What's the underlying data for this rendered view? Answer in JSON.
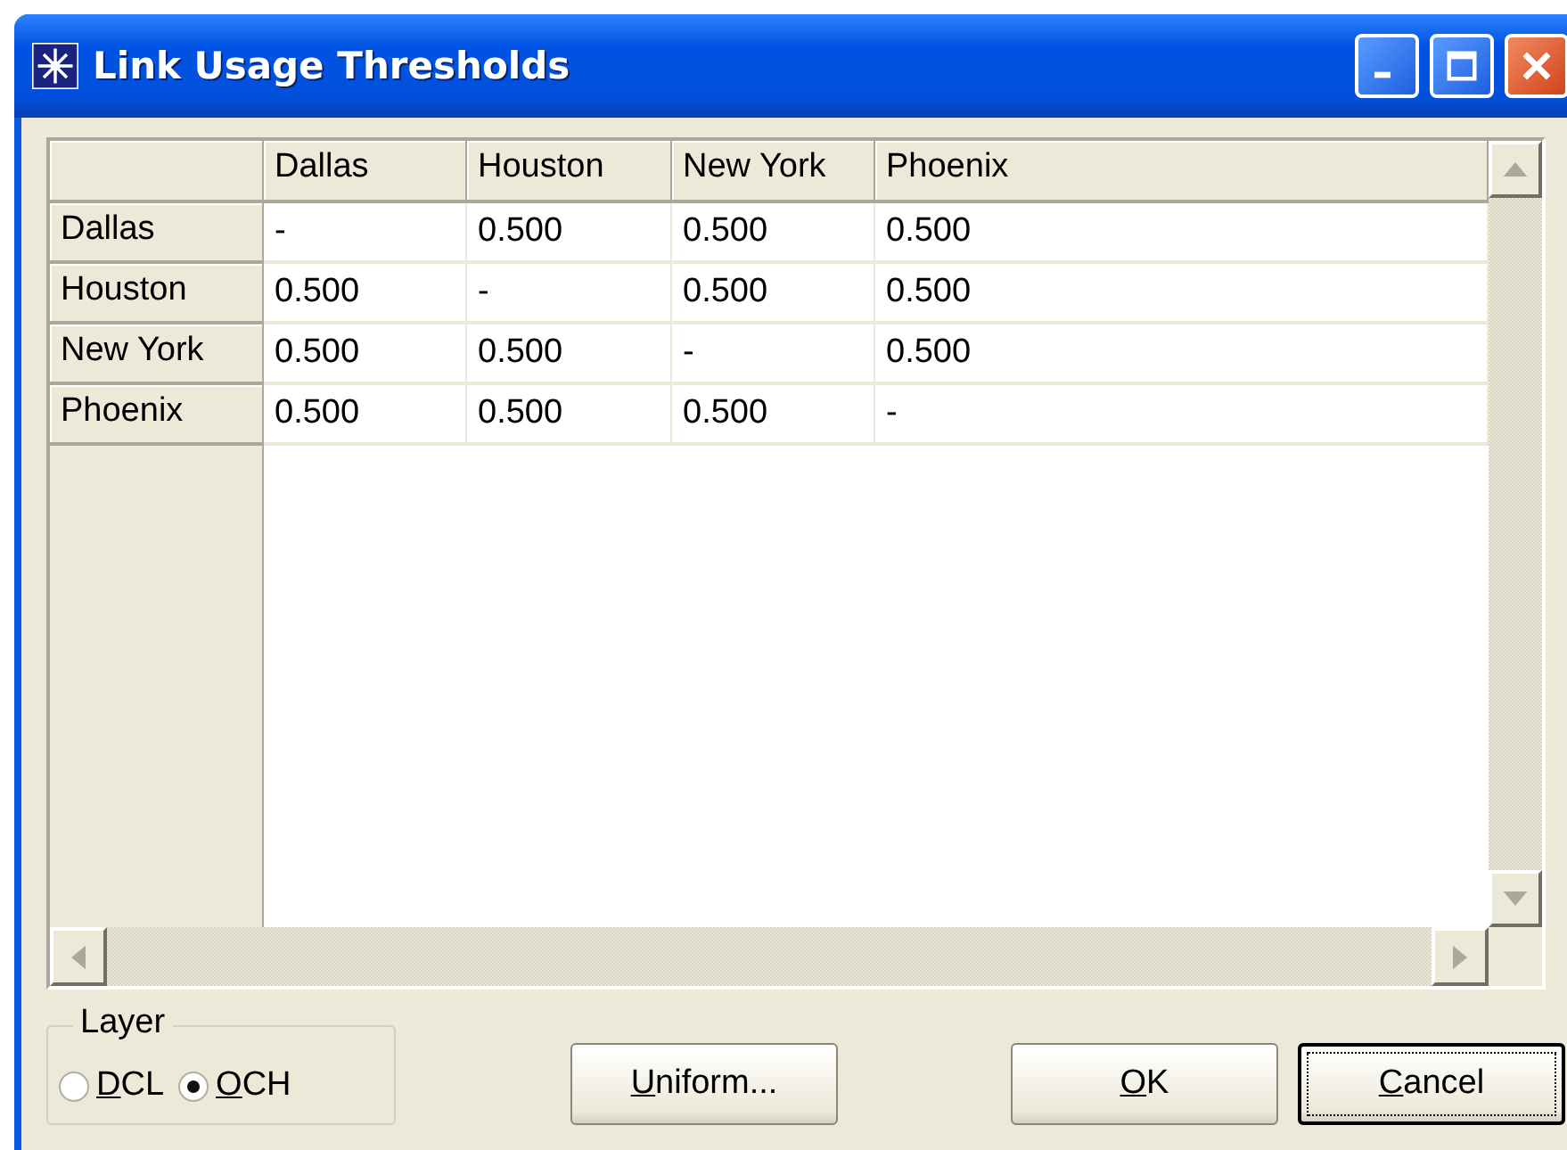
{
  "window": {
    "title": "Link Usage Thresholds"
  },
  "table": {
    "columns": [
      "Dallas",
      "Houston",
      "New York",
      "Phoenix"
    ],
    "rows": [
      {
        "header": "Dallas",
        "cells": [
          "-",
          "0.500",
          "0.500",
          "0.500"
        ]
      },
      {
        "header": "Houston",
        "cells": [
          "0.500",
          "-",
          "0.500",
          "0.500"
        ]
      },
      {
        "header": "New York",
        "cells": [
          "0.500",
          "0.500",
          "-",
          "0.500"
        ]
      },
      {
        "header": "Phoenix",
        "cells": [
          "0.500",
          "0.500",
          "0.500",
          "-"
        ]
      }
    ]
  },
  "layer": {
    "label": "Layer",
    "options": [
      {
        "access_key": "D",
        "rest": "CL",
        "selected": false
      },
      {
        "access_key": "O",
        "rest": "CH",
        "selected": true
      }
    ]
  },
  "buttons": [
    {
      "access_key": "U",
      "rest": "niform...",
      "focused": false
    },
    {
      "access_key": "O",
      "rest": "K",
      "focused": false
    },
    {
      "access_key": "C",
      "rest": "ancel",
      "focused": true
    }
  ]
}
